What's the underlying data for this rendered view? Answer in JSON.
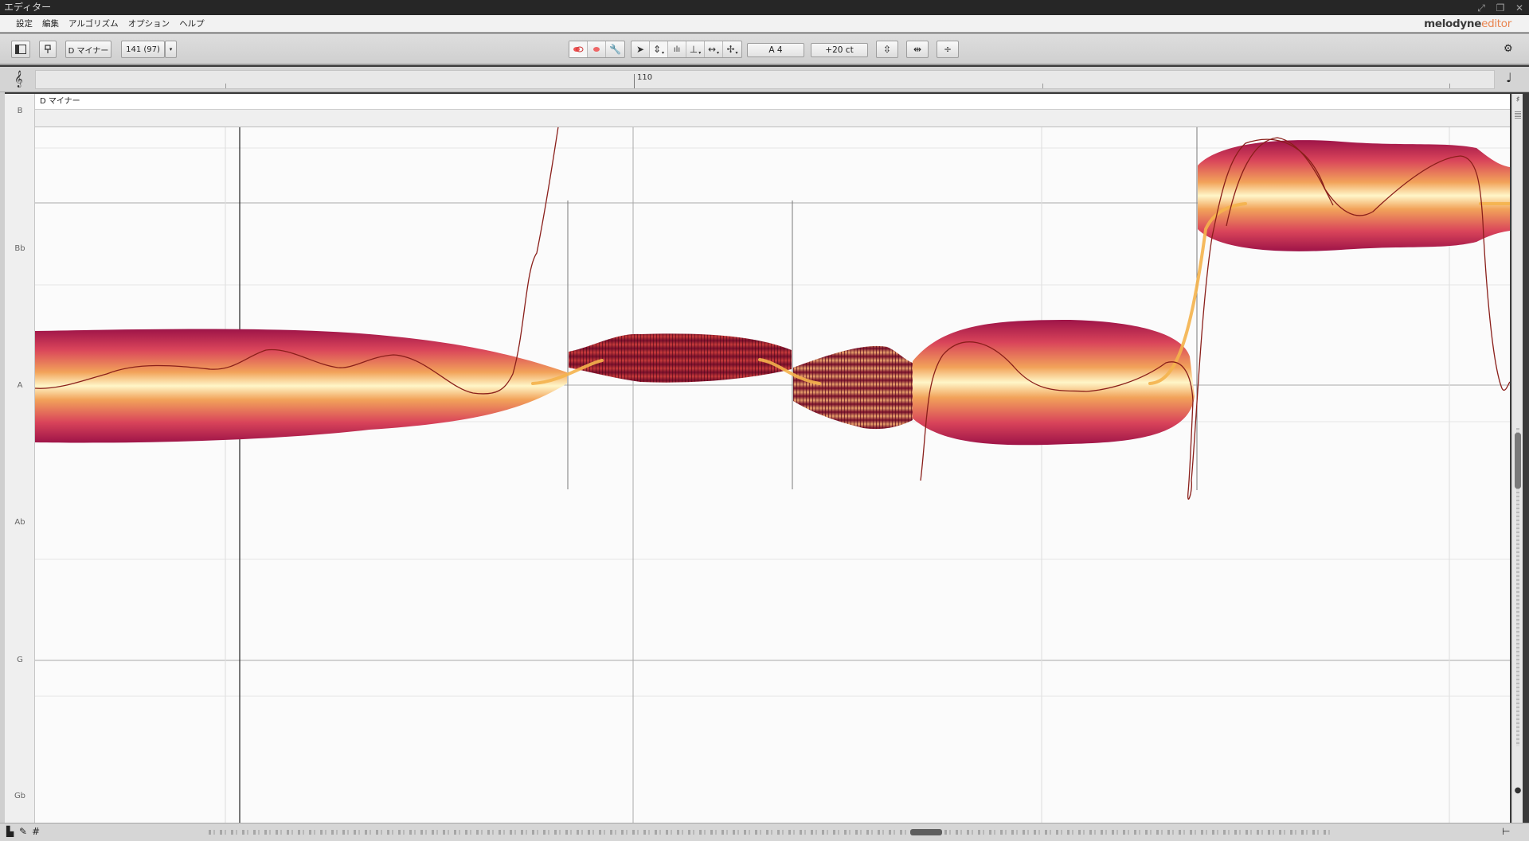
{
  "window": {
    "title": "エディター"
  },
  "menu": {
    "items": [
      "設定",
      "編集",
      "アルゴリズム",
      "オプション",
      "ヘルプ"
    ],
    "brand_main": "melodyne",
    "brand_sub": "editor"
  },
  "toolbar": {
    "scale_label": "D マイナー",
    "tempo_label": "141 (97)",
    "pitch_readout": "A 4",
    "cents_readout": "+20 ct"
  },
  "ruler": {
    "bar_label": "110"
  },
  "editor": {
    "scale_header": "D マイナー",
    "pitch_labels": [
      "B",
      "Bb",
      "A",
      "Ab",
      "G",
      "Gb"
    ]
  },
  "colors": {
    "blob_core": "#fff3c0",
    "blob_mid": "#f2b25a",
    "blob_edge": "#a8124a",
    "pitch_curve": "#8a1f1a",
    "transition_curve": "#f4b24c"
  },
  "icons": {
    "title_buttons": [
      "restore-icon",
      "maximize-icon",
      "close-icon"
    ],
    "toolbar_groups": [
      "sidebar-toggle-icon",
      "pin-icon",
      "pitch-snap-icon",
      "macro-icon",
      "wrench-icon",
      "pointer-icon",
      "pitch-tool-icon",
      "amplitude-tool-icon",
      "formant-tool-icon",
      "timing-tool-icon",
      "separation-tool-icon",
      "quantize-icon",
      "stretch-icon",
      "align-icon",
      "gear-icon"
    ]
  }
}
